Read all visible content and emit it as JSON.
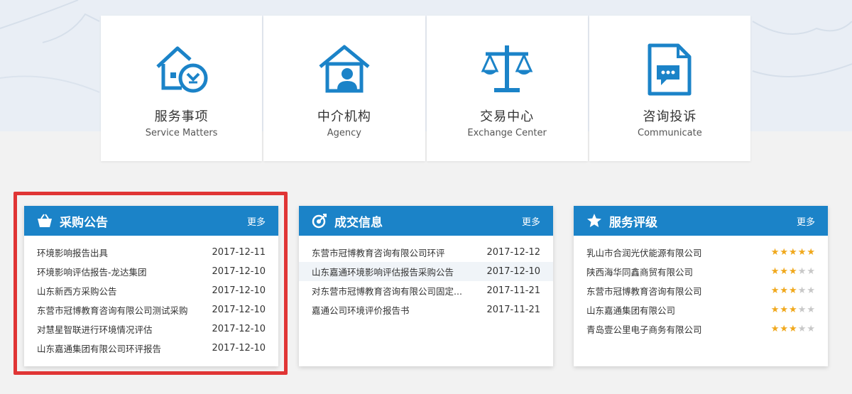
{
  "services": [
    {
      "cn": "服务事项",
      "en": "Service Matters",
      "icon": "house-clock-icon"
    },
    {
      "cn": "中介机构",
      "en": "Agency",
      "icon": "house-person-icon"
    },
    {
      "cn": "交易中心",
      "en": "Exchange Center",
      "icon": "scales-icon"
    },
    {
      "cn": "咨询投诉",
      "en": "Communicate",
      "icon": "document-chat-icon"
    }
  ],
  "colors": {
    "accent": "#1b83c8",
    "star": "#f0a81c",
    "highlight": "#e03535"
  },
  "procurement": {
    "title": "采购公告",
    "more": "更多",
    "items": [
      {
        "title": "环境影响报告出具",
        "date": "2017-12-11"
      },
      {
        "title": "环境影响评估报告-龙达集团",
        "date": "2017-12-10"
      },
      {
        "title": "山东新西方采购公告",
        "date": "2017-12-10"
      },
      {
        "title": "东营市冠博教育咨询有限公司测试采购",
        "date": "2017-12-10"
      },
      {
        "title": "对慧星智联进行环境情况评估",
        "date": "2017-12-10"
      },
      {
        "title": "山东嘉通集团有限公司环评报告",
        "date": "2017-12-10"
      }
    ]
  },
  "deals": {
    "title": "成交信息",
    "more": "更多",
    "items": [
      {
        "title": "东营市冠博教育咨询有限公司环评",
        "date": "2017-12-12"
      },
      {
        "title": "山东嘉通环境影响评估报告采购公告",
        "date": "2017-12-10"
      },
      {
        "title": "对东营市冠博教育咨询有限公司固定...",
        "date": "2017-11-21"
      },
      {
        "title": "嘉通公司环境评价报告书",
        "date": "2017-11-21"
      }
    ]
  },
  "ratings": {
    "title": "服务评级",
    "more": "更多",
    "items": [
      {
        "name": "乳山市合润光伏能源有限公司",
        "stars": 5
      },
      {
        "name": "陕西海华同鑫商贸有限公司",
        "stars": 3
      },
      {
        "name": "东营市冠博教育咨询有限公司",
        "stars": 3
      },
      {
        "name": "山东嘉通集团有限公司",
        "stars": 3
      },
      {
        "name": "青岛壹公里电子商务有限公司",
        "stars": 3
      }
    ]
  }
}
